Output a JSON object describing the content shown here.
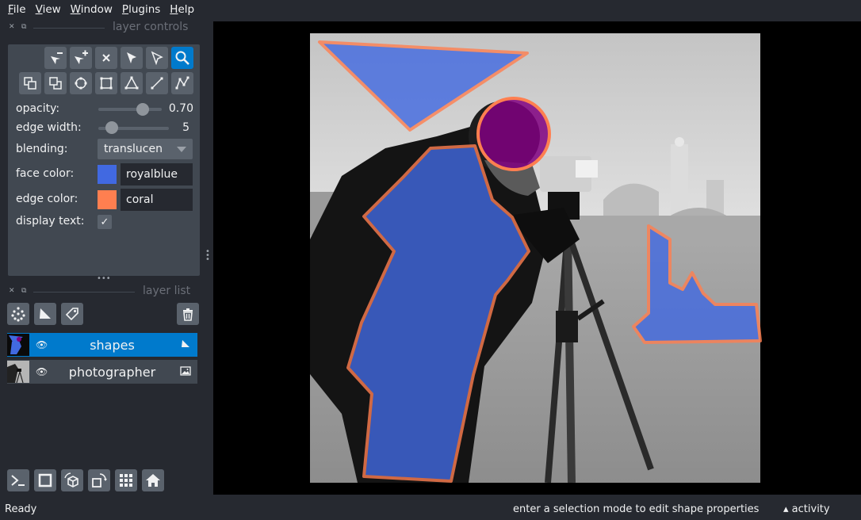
{
  "menubar": {
    "items": [
      {
        "label": "File",
        "u": "F",
        "rest": "ile"
      },
      {
        "label": "View",
        "u": "V",
        "rest": "iew"
      },
      {
        "label": "Window",
        "u": "W",
        "rest": "indow"
      },
      {
        "label": "Plugins",
        "u": "P",
        "rest": "lugins"
      },
      {
        "label": "Help",
        "u": "H",
        "rest": "elp"
      }
    ]
  },
  "layer_controls": {
    "title": "layer controls",
    "opacity_label": "opacity:",
    "opacity_value": "0.70",
    "opacity_fraction": 0.7,
    "edge_width_label": "edge width:",
    "edge_width_value": "5",
    "blending_label": "blending:",
    "blending_value": "translucen",
    "face_color_label": "face color:",
    "face_color_value": "royalblue",
    "face_color_hex": "#4169e1",
    "edge_color_label": "edge color:",
    "edge_color_value": "coral",
    "edge_color_hex": "#ff7f50",
    "display_text_label": "display text:",
    "display_text_checked": true,
    "check_glyph": "✓"
  },
  "layer_list": {
    "title": "layer list",
    "layers": [
      {
        "name": "shapes",
        "selected": true
      },
      {
        "name": "photographer",
        "selected": false
      }
    ]
  },
  "status": {
    "left": "Ready",
    "right": "enter a selection mode to edit shape properties",
    "activity": "activity",
    "activity_arrow": "▴"
  },
  "colors": {
    "accent": "#007acc",
    "panel": "#414851",
    "background": "#262930",
    "face": "#4169e1",
    "edge": "#ff7f50",
    "ellipse_face": "#800080"
  }
}
